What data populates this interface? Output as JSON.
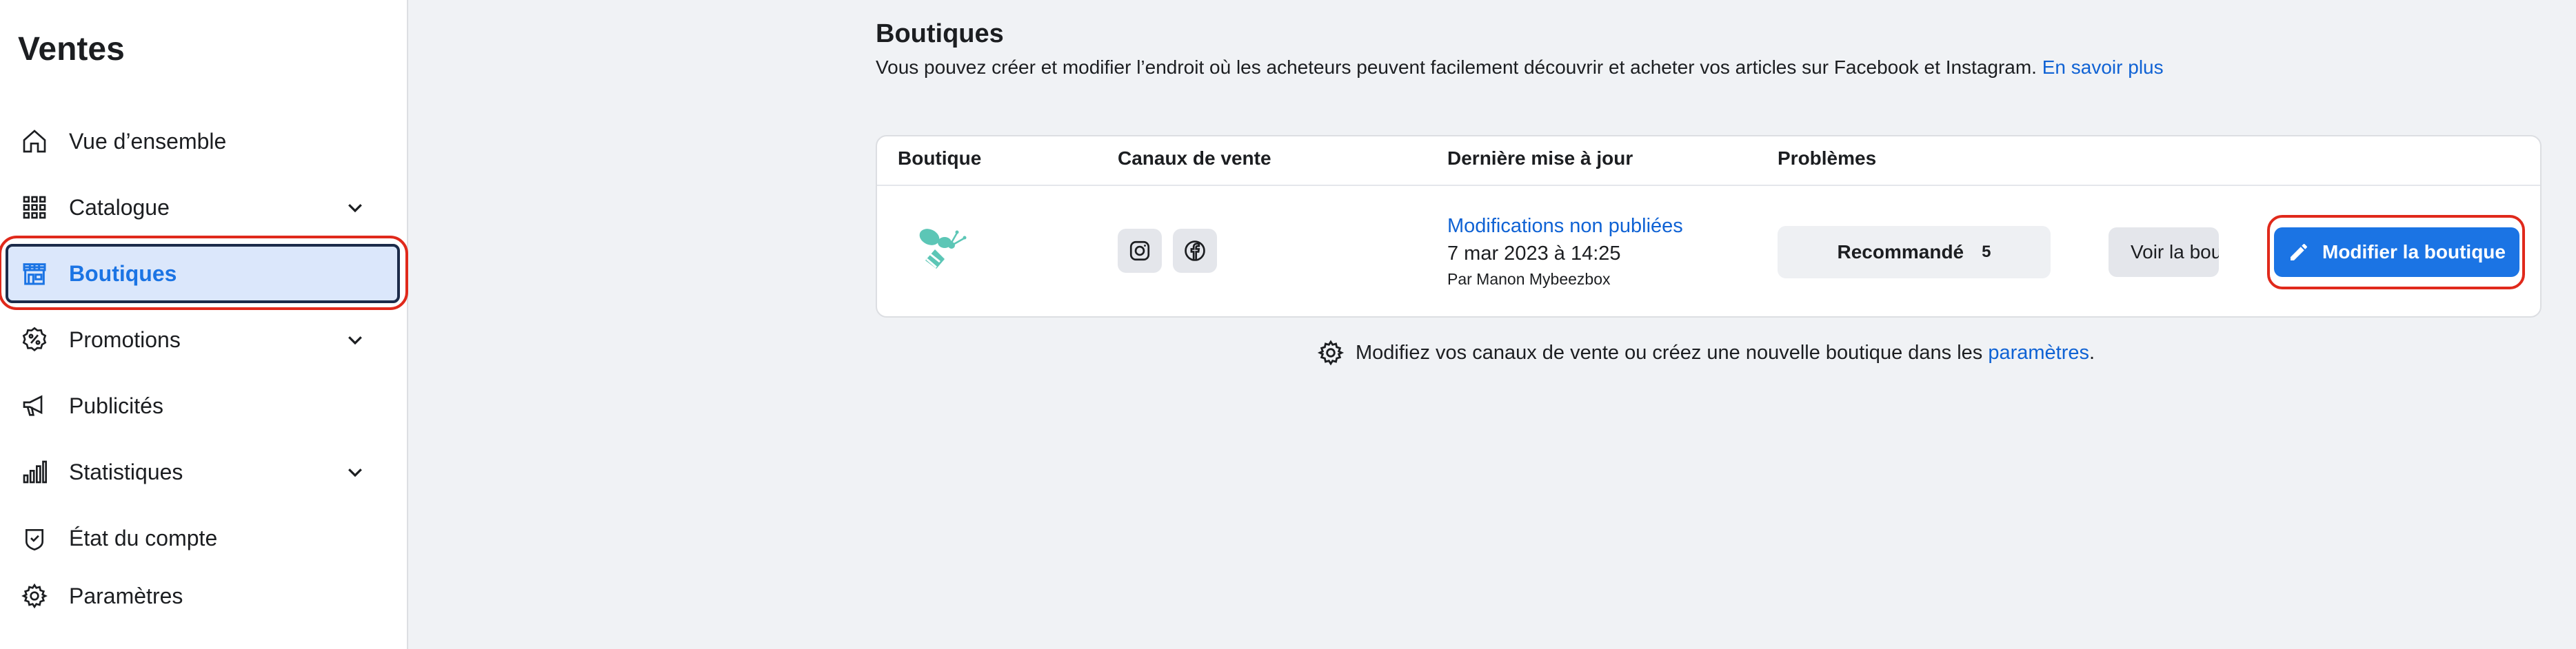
{
  "sidebar": {
    "title": "Ventes",
    "items": [
      {
        "label": "Vue d’ensemble",
        "icon": "home-icon"
      },
      {
        "label": "Catalogue",
        "icon": "grid-icon",
        "expandable": true
      },
      {
        "label": "Boutiques",
        "icon": "storefront-icon",
        "active": true
      },
      {
        "label": "Promotions",
        "icon": "percent-badge-icon",
        "expandable": true
      },
      {
        "label": "Publicités",
        "icon": "megaphone-icon"
      },
      {
        "label": "Statistiques",
        "icon": "bar-chart-icon",
        "expandable": true
      },
      {
        "label": "État du compte",
        "icon": "shield-check-icon"
      },
      {
        "label": "Paramètres",
        "icon": "gear-icon"
      }
    ]
  },
  "main": {
    "title": "Boutiques",
    "description": "Vous pouvez créer et modifier l’endroit où les acheteurs peuvent facilement découvrir et acheter vos articles sur Facebook et Instagram.",
    "learn_more": "En savoir plus",
    "table": {
      "headers": {
        "shop": "Boutique",
        "channels": "Canaux de vente",
        "last_update": "Dernière mise à jour",
        "issues": "Problèmes"
      },
      "row": {
        "logo_icon": "bee-logo-icon",
        "channels": [
          "instagram-icon",
          "facebook-icon"
        ],
        "update_status": "Modifications non publiées",
        "update_date": "7 mar 2023 à 14:25",
        "update_by": "Par Manon Mybeezbox",
        "issues_label": "Recommandé",
        "issues_count": "5",
        "view_button": "Voir la bou…",
        "edit_button": "Modifier la boutique"
      }
    },
    "footer": {
      "text": "Modifiez vos canaux de vente ou créez une nouvelle boutique dans les",
      "link": "paramètres",
      "end": "."
    }
  },
  "colors": {
    "accent": "#1b74e4",
    "link": "#0f62d4",
    "active_bg": "#dbe7fb",
    "highlight": "#e0291b",
    "brand_logo": "#5cc6b6"
  }
}
